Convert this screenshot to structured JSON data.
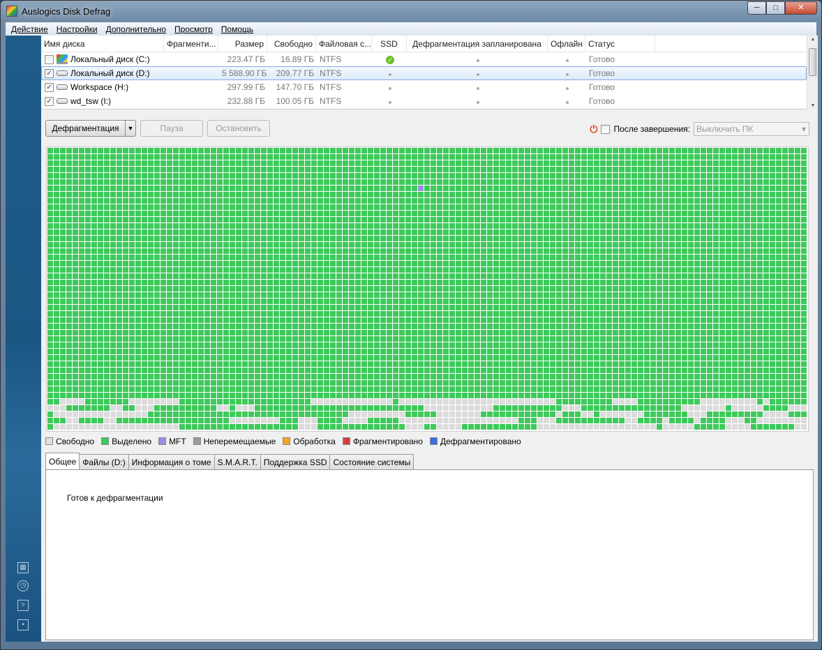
{
  "window": {
    "title": "Auslogics Disk Defrag",
    "minimize": "─",
    "maximize": "□",
    "close": "✕"
  },
  "menu": [
    "Действие",
    "Настройки",
    "Дополнительно",
    "Просмотр",
    "Помощь"
  ],
  "columns": [
    "Имя диска",
    "Фрагменти...",
    "Размер",
    "Свободно",
    "Файловая с...",
    "SSD",
    "Дефрагментация запланирована",
    "Офлайн",
    "Статус"
  ],
  "disks": [
    {
      "name": "Локальный диск (C:)",
      "checked": false,
      "size": "223.47 ГБ",
      "free": "16.89 ГБ",
      "fs": "NTFS",
      "ssd": true,
      "status": "Готово",
      "system": true
    },
    {
      "name": "Локальный диск (D:)",
      "checked": true,
      "size": "5 588.90 ГБ",
      "free": "209.77 ГБ",
      "fs": "NTFS",
      "ssd": false,
      "status": "Готово",
      "selected": true
    },
    {
      "name": "Workspace (H:)",
      "checked": true,
      "size": "297.99 ГБ",
      "free": "147.70 ГБ",
      "fs": "NTFS",
      "ssd": false,
      "status": "Готово"
    },
    {
      "name": "wd_tsw (I:)",
      "checked": true,
      "size": "232.88 ГБ",
      "free": "100.05 ГБ",
      "fs": "NTFS",
      "ssd": false,
      "status": "Готово"
    }
  ],
  "toolbar": {
    "defrag": "Дефрагментация",
    "pause": "Пауза",
    "stop": "Остановить",
    "after_label": "После завершения:",
    "after_value": "Выключить ПК"
  },
  "legend": [
    {
      "label": "Свободно",
      "color": "#e0e0e0"
    },
    {
      "label": "Выделено",
      "color": "#3ec95b"
    },
    {
      "label": "MFT",
      "color": "#9a8ee0"
    },
    {
      "label": "Неперемещаемые",
      "color": "#9a9a9a"
    },
    {
      "label": "Обработка",
      "color": "#f5a623"
    },
    {
      "label": "Фрагментировано",
      "color": "#e03b3b"
    },
    {
      "label": "Дефрагментировано",
      "color": "#3a6fe0"
    }
  ],
  "tabs": [
    "Общее",
    "Файлы (D:)",
    "Информация о томе",
    "S.M.A.R.T.",
    "Поддержка SSD",
    "Состояние системы"
  ],
  "panel": {
    "message": "Готов к дефрагментации"
  }
}
